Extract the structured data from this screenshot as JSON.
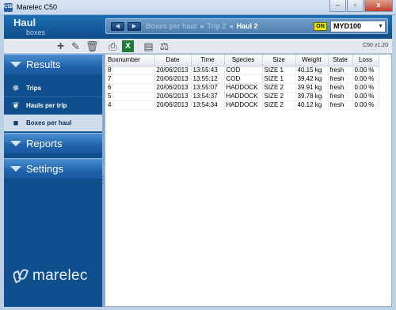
{
  "window": {
    "title": "Marelec C50",
    "app_icon": "C50",
    "minimize": "–",
    "maximize": "▫",
    "close": "x"
  },
  "header": {
    "logo_main": "Haul",
    "logo_sub": "boxes",
    "breadcrumb": [
      "Boxes per haul",
      "Trip 2",
      "Haul 2"
    ],
    "breadcrumb_sep": "»",
    "status_badge": "ON",
    "device": "MYD100"
  },
  "toolbar": {
    "icons": [
      "add-icon",
      "edit-icon",
      "delete-icon",
      "print-icon",
      "excel-export-icon",
      "print-label-icon",
      "scale-icon"
    ],
    "version": "C50 v1.20"
  },
  "sidebar": {
    "sections": [
      {
        "label": "Results"
      },
      {
        "label": "Reports"
      },
      {
        "label": "Settings"
      }
    ],
    "items": [
      {
        "label": "Trips",
        "icon": "ship-wheel-icon"
      },
      {
        "label": "Hauls per trip",
        "icon": "fish-icon"
      },
      {
        "label": "Boxes per haul",
        "icon": "box-icon"
      }
    ],
    "brand": "marelec"
  },
  "table": {
    "columns": [
      "Boxnumber",
      "Date",
      "Time",
      "Species",
      "Size",
      "Weight",
      "State",
      "Loss"
    ],
    "rows": [
      [
        "8",
        "20/06/2013",
        "13:55:43",
        "COD",
        "SIZE 1",
        "40.15 kg",
        "fresh",
        "0.00 %"
      ],
      [
        "7",
        "20/06/2013",
        "13:55:12",
        "COD",
        "SIZE 1",
        "39.42 kg",
        "fresh",
        "0.00 %"
      ],
      [
        "6",
        "20/06/2013",
        "13:55:07",
        "HADDOCK",
        "SIZE 2",
        "39.91 kg",
        "fresh",
        "0.00 %"
      ],
      [
        "5",
        "20/06/2013",
        "13:54:37",
        "HADDOCK",
        "SIZE 2",
        "39.78 kg",
        "fresh",
        "0.00 %"
      ],
      [
        "4",
        "20/06/2013",
        "13:54:34",
        "HADDOCK",
        "SIZE 2",
        "40.12 kg",
        "fresh",
        "0.00 %"
      ]
    ]
  },
  "colors": {
    "accent": "#1d6fb3",
    "sidebar": "#0f4f8e",
    "on_badge": "#e8e200"
  }
}
